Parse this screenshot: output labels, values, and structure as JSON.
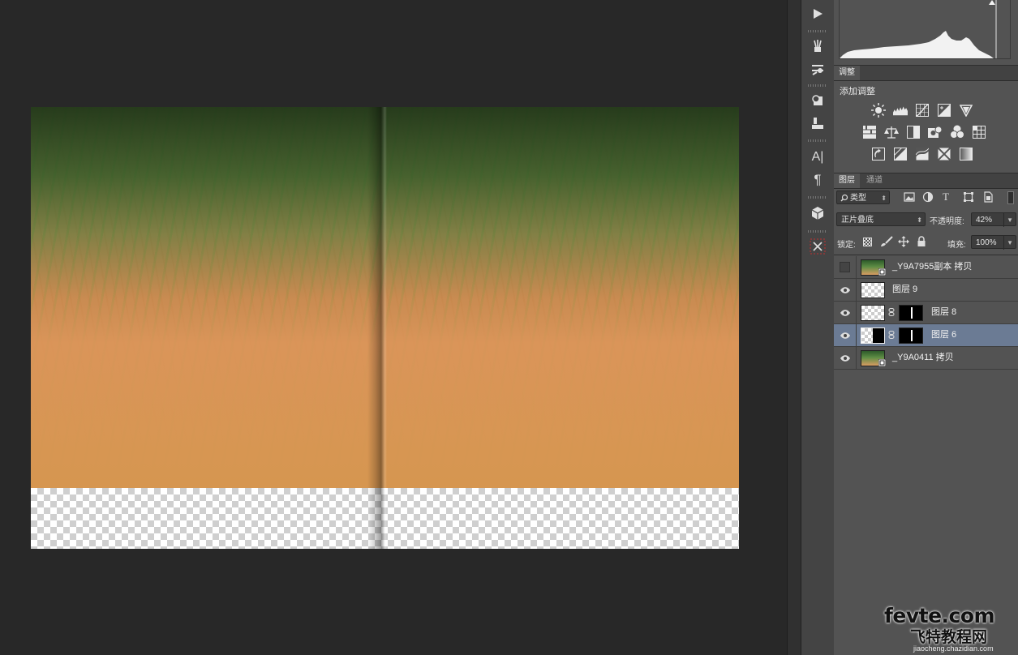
{
  "document": {
    "description_colors": {
      "grass_orange": "#d8975c",
      "grass_green": "#4e8a3c",
      "background_dark": "#282828"
    }
  },
  "tools": [
    {
      "name": "play-icon",
      "glyph": "▶"
    },
    {
      "name": "brush-presets-icon",
      "glyph": ""
    },
    {
      "name": "brush-settings-icon",
      "glyph": ""
    },
    {
      "name": "clone-source-icon",
      "glyph": ""
    },
    {
      "name": "tool-presets-icon",
      "glyph": ""
    },
    {
      "name": "character-icon",
      "glyph": "A|"
    },
    {
      "name": "paragraph-icon",
      "glyph": "¶"
    },
    {
      "name": "3d-icon",
      "glyph": ""
    },
    {
      "name": "close-panel-icon",
      "glyph": "✕"
    }
  ],
  "adjustments": {
    "tab_label": "调整",
    "title": "添加调整"
  },
  "layers_panel": {
    "tabs": [
      {
        "label": "图层",
        "active": true
      },
      {
        "label": "通道",
        "active": false
      }
    ],
    "filter_kind": "类型",
    "blend_mode": "正片叠底",
    "opacity_label": "不透明度:",
    "opacity_value": "42%",
    "lock_label": "锁定:",
    "fill_label": "填充:",
    "fill_value": "100%",
    "layers": [
      {
        "name": "_Y9A7955副本 拷贝",
        "visible": false,
        "thumb": "photo",
        "mask": false,
        "selected": false,
        "smart": true
      },
      {
        "name": "图层 9",
        "visible": true,
        "thumb": "checker",
        "mask": false,
        "selected": false,
        "smart": false
      },
      {
        "name": "图层 8",
        "visible": true,
        "thumb": "checker",
        "mask": true,
        "selected": false,
        "smart": false
      },
      {
        "name": "图层 6",
        "visible": true,
        "thumb": "checker-black",
        "mask": true,
        "selected": true,
        "smart": false
      },
      {
        "name": "_Y9A0411 拷贝",
        "visible": true,
        "thumb": "photo",
        "mask": false,
        "selected": false,
        "smart": true
      }
    ]
  },
  "watermark": {
    "line1": "fevte.com",
    "line2": "飞特教程网",
    "line3": "jiaocheng.chazidian.com"
  }
}
